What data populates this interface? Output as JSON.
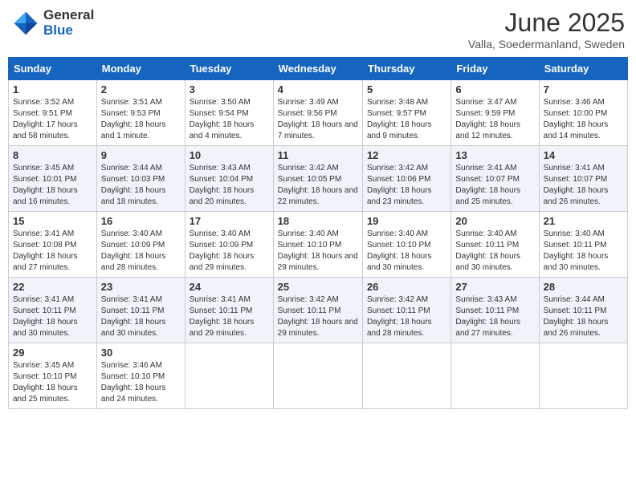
{
  "header": {
    "logo_general": "General",
    "logo_blue": "Blue",
    "month_title": "June 2025",
    "subtitle": "Valla, Soedermanland, Sweden"
  },
  "weekdays": [
    "Sunday",
    "Monday",
    "Tuesday",
    "Wednesday",
    "Thursday",
    "Friday",
    "Saturday"
  ],
  "weeks": [
    [
      {
        "day": "1",
        "sunrise": "3:52 AM",
        "sunset": "9:51 PM",
        "daylight": "17 hours and 58 minutes."
      },
      {
        "day": "2",
        "sunrise": "3:51 AM",
        "sunset": "9:53 PM",
        "daylight": "18 hours and 1 minute."
      },
      {
        "day": "3",
        "sunrise": "3:50 AM",
        "sunset": "9:54 PM",
        "daylight": "18 hours and 4 minutes."
      },
      {
        "day": "4",
        "sunrise": "3:49 AM",
        "sunset": "9:56 PM",
        "daylight": "18 hours and 7 minutes."
      },
      {
        "day": "5",
        "sunrise": "3:48 AM",
        "sunset": "9:57 PM",
        "daylight": "18 hours and 9 minutes."
      },
      {
        "day": "6",
        "sunrise": "3:47 AM",
        "sunset": "9:59 PM",
        "daylight": "18 hours and 12 minutes."
      },
      {
        "day": "7",
        "sunrise": "3:46 AM",
        "sunset": "10:00 PM",
        "daylight": "18 hours and 14 minutes."
      }
    ],
    [
      {
        "day": "8",
        "sunrise": "3:45 AM",
        "sunset": "10:01 PM",
        "daylight": "18 hours and 16 minutes."
      },
      {
        "day": "9",
        "sunrise": "3:44 AM",
        "sunset": "10:03 PM",
        "daylight": "18 hours and 18 minutes."
      },
      {
        "day": "10",
        "sunrise": "3:43 AM",
        "sunset": "10:04 PM",
        "daylight": "18 hours and 20 minutes."
      },
      {
        "day": "11",
        "sunrise": "3:42 AM",
        "sunset": "10:05 PM",
        "daylight": "18 hours and 22 minutes."
      },
      {
        "day": "12",
        "sunrise": "3:42 AM",
        "sunset": "10:06 PM",
        "daylight": "18 hours and 23 minutes."
      },
      {
        "day": "13",
        "sunrise": "3:41 AM",
        "sunset": "10:07 PM",
        "daylight": "18 hours and 25 minutes."
      },
      {
        "day": "14",
        "sunrise": "3:41 AM",
        "sunset": "10:07 PM",
        "daylight": "18 hours and 26 minutes."
      }
    ],
    [
      {
        "day": "15",
        "sunrise": "3:41 AM",
        "sunset": "10:08 PM",
        "daylight": "18 hours and 27 minutes."
      },
      {
        "day": "16",
        "sunrise": "3:40 AM",
        "sunset": "10:09 PM",
        "daylight": "18 hours and 28 minutes."
      },
      {
        "day": "17",
        "sunrise": "3:40 AM",
        "sunset": "10:09 PM",
        "daylight": "18 hours and 29 minutes."
      },
      {
        "day": "18",
        "sunrise": "3:40 AM",
        "sunset": "10:10 PM",
        "daylight": "18 hours and 29 minutes."
      },
      {
        "day": "19",
        "sunrise": "3:40 AM",
        "sunset": "10:10 PM",
        "daylight": "18 hours and 30 minutes."
      },
      {
        "day": "20",
        "sunrise": "3:40 AM",
        "sunset": "10:11 PM",
        "daylight": "18 hours and 30 minutes."
      },
      {
        "day": "21",
        "sunrise": "3:40 AM",
        "sunset": "10:11 PM",
        "daylight": "18 hours and 30 minutes."
      }
    ],
    [
      {
        "day": "22",
        "sunrise": "3:41 AM",
        "sunset": "10:11 PM",
        "daylight": "18 hours and 30 minutes."
      },
      {
        "day": "23",
        "sunrise": "3:41 AM",
        "sunset": "10:11 PM",
        "daylight": "18 hours and 30 minutes."
      },
      {
        "day": "24",
        "sunrise": "3:41 AM",
        "sunset": "10:11 PM",
        "daylight": "18 hours and 29 minutes."
      },
      {
        "day": "25",
        "sunrise": "3:42 AM",
        "sunset": "10:11 PM",
        "daylight": "18 hours and 29 minutes."
      },
      {
        "day": "26",
        "sunrise": "3:42 AM",
        "sunset": "10:11 PM",
        "daylight": "18 hours and 28 minutes."
      },
      {
        "day": "27",
        "sunrise": "3:43 AM",
        "sunset": "10:11 PM",
        "daylight": "18 hours and 27 minutes."
      },
      {
        "day": "28",
        "sunrise": "3:44 AM",
        "sunset": "10:11 PM",
        "daylight": "18 hours and 26 minutes."
      }
    ],
    [
      {
        "day": "29",
        "sunrise": "3:45 AM",
        "sunset": "10:10 PM",
        "daylight": "18 hours and 25 minutes."
      },
      {
        "day": "30",
        "sunrise": "3:46 AM",
        "sunset": "10:10 PM",
        "daylight": "18 hours and 24 minutes."
      },
      null,
      null,
      null,
      null,
      null
    ]
  ]
}
